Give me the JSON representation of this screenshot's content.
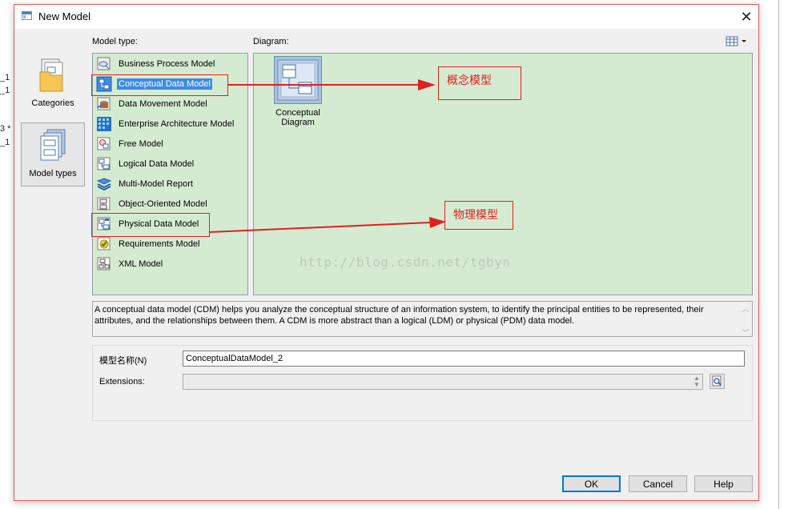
{
  "background": {
    "fragments": [
      "_1",
      "_1",
      "3 *",
      "_1"
    ]
  },
  "dialog": {
    "title": "New Model",
    "close_glyph": "✕"
  },
  "categories": [
    {
      "label": "Categories",
      "icon": "categories-icon",
      "selected": false
    },
    {
      "label": "Model types",
      "icon": "model-types-icon",
      "selected": true
    }
  ],
  "model_type": {
    "label": "Model type:",
    "items": [
      {
        "label": "Business Process Model",
        "icon": "business-process-icon"
      },
      {
        "label": "Conceptual Data Model",
        "icon": "conceptual-data-icon",
        "selected": true
      },
      {
        "label": "Data Movement Model",
        "icon": "data-movement-icon"
      },
      {
        "label": "Enterprise Architecture Model",
        "icon": "enterprise-architecture-icon"
      },
      {
        "label": "Free Model",
        "icon": "free-model-icon"
      },
      {
        "label": "Logical Data Model",
        "icon": "logical-data-icon"
      },
      {
        "label": "Multi-Model Report",
        "icon": "multi-model-report-icon"
      },
      {
        "label": "Object-Oriented Model",
        "icon": "object-oriented-icon"
      },
      {
        "label": "Physical Data Model",
        "icon": "physical-data-icon"
      },
      {
        "label": "Requirements Model",
        "icon": "requirements-icon"
      },
      {
        "label": "XML Model",
        "icon": "xml-model-icon"
      }
    ]
  },
  "diagram": {
    "label": "Diagram:",
    "items": [
      {
        "label": "Conceptual Diagram",
        "icon": "conceptual-diagram-icon"
      }
    ]
  },
  "description": "A conceptual data model (CDM) helps you analyze the conceptual structure of an information system, to identify the principal entities to be represented, their attributes, and the relationships between them. A CDM is more abstract than a logical (LDM) or physical (PDM) data model.",
  "form": {
    "name_label": "模型名称(N)",
    "name_value": "ConceptualDataModel_2",
    "extensions_label": "Extensions:",
    "extensions_value": ""
  },
  "buttons": {
    "ok": "OK",
    "cancel": "Cancel",
    "help": "Help"
  },
  "annotations": {
    "conceptual": "概念模型",
    "physical": "物理模型",
    "color": "#e02020"
  },
  "watermark": "http://blog.csdn.net/tgbyn",
  "colors": {
    "panel_green": "#d5ebd1",
    "selection_blue": "#3c8ce5",
    "default_button_border": "#0078d7"
  }
}
